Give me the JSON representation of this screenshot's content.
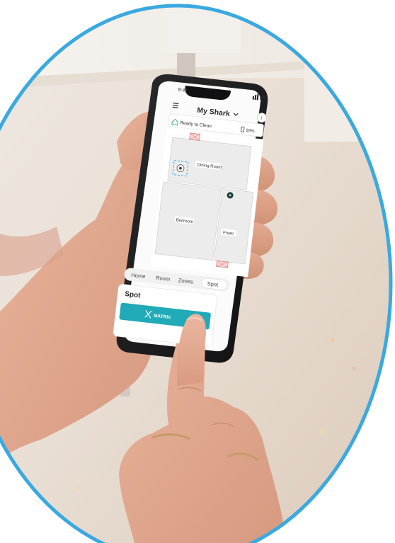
{
  "status_bar": {
    "time": "9:41"
  },
  "app": {
    "title": "My Shark",
    "title_chevron_icon": "chevron-down-icon",
    "menu_icon": "hamburger-menu-icon",
    "info_icon": "info-icon"
  },
  "status": {
    "text": "Ready to Clean",
    "battery": "93%",
    "home_icon": "home-icon",
    "battery_icon": "battery-icon"
  },
  "map": {
    "rooms": [
      "Dining Room",
      "Bedroom",
      "Foyer"
    ]
  },
  "tabs": [
    {
      "label": "Home",
      "selected": false
    },
    {
      "label": "Room",
      "selected": false
    },
    {
      "label": "Zones",
      "selected": false
    },
    {
      "label": "Spot",
      "selected": true
    }
  ],
  "panel": {
    "title": "Spot",
    "button_label": "MATRIX",
    "button_icon": "matrix-clean-icon"
  },
  "colors": {
    "accent_blue": "#3aa9e0",
    "button_teal": "#21aab8",
    "status_green": "#3bb273",
    "no_go_red": "#e07b7b"
  }
}
